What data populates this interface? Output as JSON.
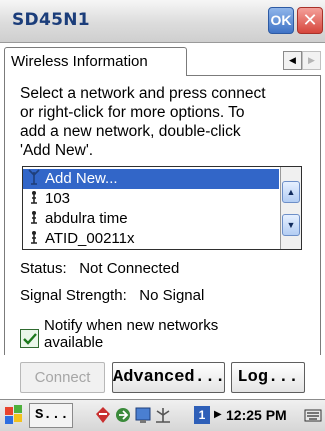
{
  "window": {
    "title": "SD45N1",
    "ok_label": "OK",
    "close_label": "✕"
  },
  "tab": {
    "label": "Wireless Information"
  },
  "instructions": "Select a network and press connect\nor right-click for more options.  To\nadd a new network, double-click\n'Add New'.",
  "networks": [
    {
      "label": "Add New...",
      "icon": "add-network-icon",
      "selected": true
    },
    {
      "label": "103",
      "icon": "network-icon",
      "selected": false
    },
    {
      "label": "abdulra time",
      "icon": "network-icon",
      "selected": false
    },
    {
      "label": "ATID_00211x",
      "icon": "network-icon",
      "selected": false
    }
  ],
  "status": {
    "label": "Status:",
    "value": "Not Connected"
  },
  "signal": {
    "label": "Signal Strength:",
    "value": "No Signal"
  },
  "notify": {
    "label": "Notify when new networks\navailable",
    "checked": true
  },
  "buttons": {
    "connect": "Connect",
    "advanced": "Advanced...",
    "log": "Log..."
  },
  "taskbar": {
    "task_label": "S...",
    "page_number": "1",
    "time": "12:25 PM"
  },
  "colors": {
    "selection": "#3266c8",
    "title_text": "#1b3d7a",
    "ok_blue": "#3f73c6",
    "close_red": "#d6463c"
  }
}
